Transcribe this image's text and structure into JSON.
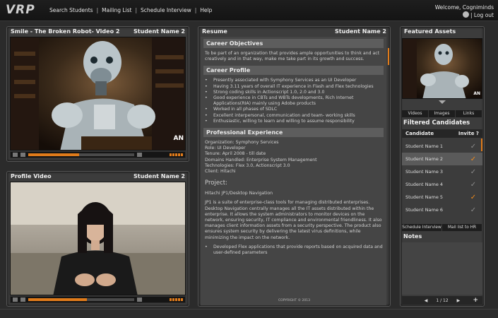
{
  "app": {
    "logo": "VRP",
    "nav": [
      "Search Students",
      "Mailing List",
      "Schedule Interview",
      "Help"
    ],
    "welcome": "Welcome, Cogniminds",
    "logout": "Log out"
  },
  "video1": {
    "title": "Smile - The Broken Robot- Video 2",
    "student": "Student Name 2",
    "watermark": "AN",
    "progress": 0.48
  },
  "video2": {
    "title": "Profile Video",
    "student": "Student Name 2",
    "progress": 0.55
  },
  "resume": {
    "title": "Resume",
    "student": "Student Name 2",
    "career_objectives_h": "Career Objectives",
    "career_objectives": "To be part of an organization that provides ample opportunities to think and act creatively and in that way, make me take part in its growth and success.",
    "career_profile_h": "Career Profile",
    "career_profile": [
      "Presently associated with Symphony Services as an UI Developer",
      "Having 3.11 years of overall IT experience in Flash and Flex technologies",
      "Strong coding skills in Actionscript 1.0, 2.0 and 3.0",
      "Good experience in CBTs and WBTs developments, Rich Internet Applications(RIA) mainly using Adobe products",
      "Worked in all phases of SDLC",
      "Excellent interpersonal, communication and team- working skills",
      "Enthusiastic, willing to learn and willing to assume responsibility"
    ],
    "experience_h": "Professional Experience",
    "experience": [
      "Organization: Symphony Services",
      "Role: UI Developer",
      "Tenure: April 2008 - till date",
      "Domains Handled: Enterprise System Management",
      "Technologies: Flex 3.0, Actionscript 3.0",
      "Client: Hitachi"
    ],
    "project_h": "Project:",
    "project_name": "Hitachi JP1/Desktop Navigation",
    "project_desc": "JP1 is a suite of enterprise-class tools for managing distributed enterprises. Desktop Navigation centrally manages all the IT assets distributed within the enterprise. It allows the system administrators to monitor devices on the network, ensuring security, IT compliance and environmental friendliness.  It also manages client information assets from a security perspective. The product also ensures system security by delivering the latest virus definitions, while minimizing the impact on the network.",
    "project_bullets": [
      "Developed Flex applications that provide reports based on acquired data and user-defined parameters"
    ],
    "copyright": "COPYRIGHT © 2013"
  },
  "featured": {
    "title": "Featured Assets",
    "watermark": "AN",
    "tabs": [
      "Videos",
      "Images",
      "Links"
    ]
  },
  "candidates": {
    "title": "Filtered Candidates",
    "col_candidate": "Candidate",
    "col_invite": "Invite ?",
    "rows": [
      {
        "name": "Student Name 1",
        "invited": false,
        "selected": false
      },
      {
        "name": "Student Name 2",
        "invited": true,
        "selected": true
      },
      {
        "name": "Student Name 3",
        "invited": false,
        "selected": false
      },
      {
        "name": "Student Name 4",
        "invited": false,
        "selected": false
      },
      {
        "name": "Student Name 5",
        "invited": true,
        "selected": false
      },
      {
        "name": "Student Name 6",
        "invited": false,
        "selected": false
      }
    ],
    "btn_schedule": "Schedule Interview",
    "btn_mail": "Mail list to HR"
  },
  "notes": {
    "title": "Notes",
    "page": "1 / 12",
    "prev": "◀",
    "next": "▶",
    "add": "+"
  },
  "colors": {
    "accent": "#e07b1a",
    "panel": "#3c3c3c",
    "bg": "#2b2b2b"
  }
}
